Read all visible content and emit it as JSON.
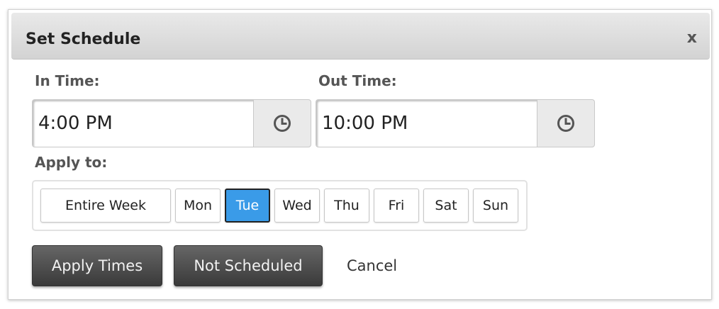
{
  "dialog": {
    "title": "Set Schedule",
    "close_label": "x"
  },
  "in_time": {
    "label": "In Time:",
    "value": "4:00 PM",
    "picker_icon": "clock-icon"
  },
  "out_time": {
    "label": "Out Time:",
    "value": "10:00 PM",
    "picker_icon": "clock-icon"
  },
  "apply_to": {
    "label": "Apply to:",
    "options": [
      {
        "label": "Entire Week",
        "selected": false
      },
      {
        "label": "Mon",
        "selected": false
      },
      {
        "label": "Tue",
        "selected": true
      },
      {
        "label": "Wed",
        "selected": false
      },
      {
        "label": "Thu",
        "selected": false
      },
      {
        "label": "Fri",
        "selected": false
      },
      {
        "label": "Sat",
        "selected": false
      },
      {
        "label": "Sun",
        "selected": false
      }
    ]
  },
  "actions": {
    "apply_label": "Apply Times",
    "not_scheduled_label": "Not Scheduled",
    "cancel_label": "Cancel"
  },
  "colors": {
    "selected_day": "#3a9be8",
    "action_button": "#4a4a4a"
  }
}
